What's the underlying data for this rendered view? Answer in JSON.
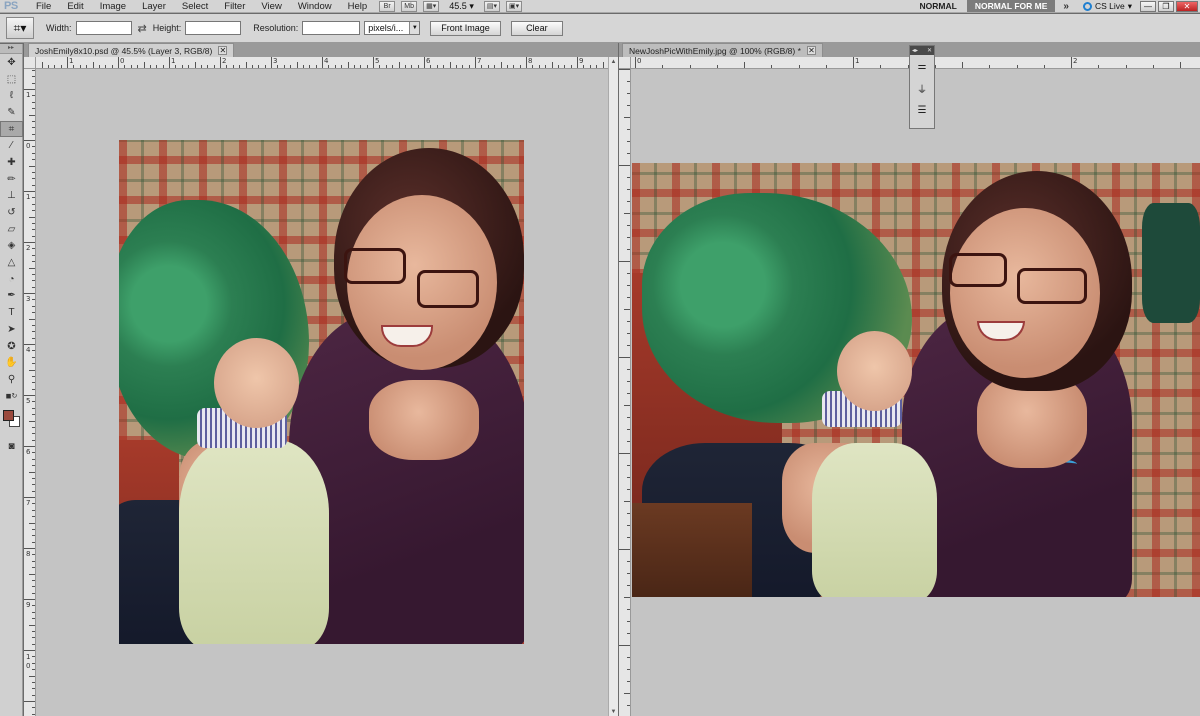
{
  "app": {
    "logo": "PS"
  },
  "menu": [
    "File",
    "Edit",
    "Image",
    "Layer",
    "Select",
    "Filter",
    "View",
    "Window",
    "Help"
  ],
  "appbar": {
    "bridge": "Br",
    "minibridge": "Mb",
    "zoom": "45.5"
  },
  "workspace": {
    "normal": "NORMAL",
    "normal_for_me": "NORMAL FOR ME",
    "more": "»",
    "cs_live": "CS Live"
  },
  "options": {
    "width_label": "Width:",
    "height_label": "Height:",
    "resolution_label": "Resolution:",
    "width_value": "",
    "height_value": "",
    "resolution_value": "",
    "units": "pixels/i...",
    "front_image": "Front Image",
    "clear": "Clear"
  },
  "documents": [
    {
      "title": "JoshEmily8x10.psd @ 45.5% (Layer 3, RGB/8)",
      "active": true
    },
    {
      "title": "NewJoshPicWithEmily.jpg @ 100% (RGB/8) *",
      "active": false
    }
  ],
  "rulers": {
    "doc1_h": [
      "1",
      "0",
      "1",
      "2",
      "3",
      "4",
      "5",
      "6",
      "7",
      "8",
      "9"
    ],
    "doc1_v": [
      "1",
      "0",
      "1",
      "2",
      "3",
      "4",
      "5",
      "6",
      "7",
      "8",
      "9",
      "1",
      "0"
    ],
    "doc2_h": [
      "0",
      "1",
      "2"
    ],
    "doc2_v": []
  },
  "colors": {
    "foreground": "#9b4a3d",
    "background": "#ffffff"
  }
}
